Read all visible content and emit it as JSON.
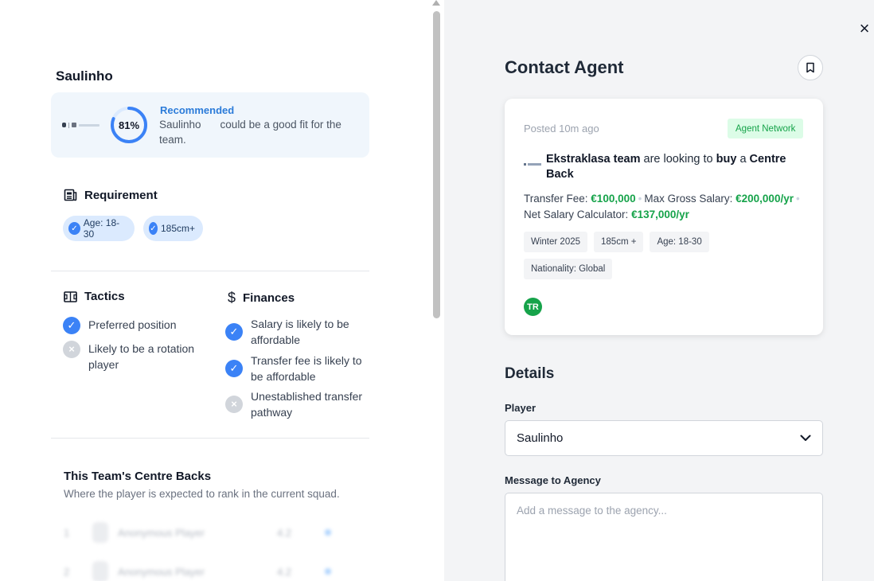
{
  "left": {
    "player_name": "Saulinho",
    "recommendation": {
      "score": "81%",
      "score_fraction": 0.81,
      "title": "Recommended",
      "text_name": "Saulinho",
      "text_rest": "could be a good fit for the team."
    },
    "requirement": {
      "heading": "Requirement",
      "chips": [
        "Age: 18-30",
        "185cm+"
      ]
    },
    "tactics": {
      "heading": "Tactics",
      "items": [
        {
          "label": "Preferred position",
          "status": "ok"
        },
        {
          "label": "Likely to be a rotation player",
          "status": "no"
        }
      ]
    },
    "finances": {
      "heading": "Finances",
      "items": [
        {
          "label": "Salary is likely to be affordable",
          "status": "ok"
        },
        {
          "label": "Transfer fee is likely to be affordable",
          "status": "ok"
        },
        {
          "label": "Unestablished transfer pathway",
          "status": "no"
        }
      ]
    },
    "centre_backs": {
      "title": "This Team's Centre Backs",
      "subtitle": "Where the player is expected to rank in the current squad.",
      "rows": [
        {
          "rank": "1",
          "name": "Anonymous Player",
          "score": "4.2"
        },
        {
          "rank": "2",
          "name": "Anonymous Player",
          "score": "4.2"
        }
      ]
    }
  },
  "right": {
    "close_icon": "close-icon",
    "title": "Contact Agent",
    "post": {
      "posted": "Posted 10m ago",
      "badge": "Agent Network",
      "team": "Ekstraklasa team",
      "are_looking_to": "are looking to",
      "action": "buy",
      "article": "a",
      "position": "Centre Back",
      "transfer_fee_label": "Transfer Fee:",
      "transfer_fee": "€100,000",
      "max_salary_label": "Max Gross Salary:",
      "max_salary": "€200,000/yr",
      "net_salary_label": "Net Salary Calculator:",
      "net_salary": "€137,000/yr",
      "tags": [
        "Winter 2025",
        "185cm +",
        "Age: 18-30",
        "Nationality: Global"
      ],
      "avatar": "TR"
    },
    "details": {
      "heading": "Details",
      "player_label": "Player",
      "player_value": "Saulinho",
      "message_label": "Message to Agency",
      "message_placeholder": "Add a message to the agency..."
    }
  },
  "colors": {
    "accent": "#3b82f6",
    "green": "#16a34a",
    "recommended": "#2b7bd9"
  }
}
